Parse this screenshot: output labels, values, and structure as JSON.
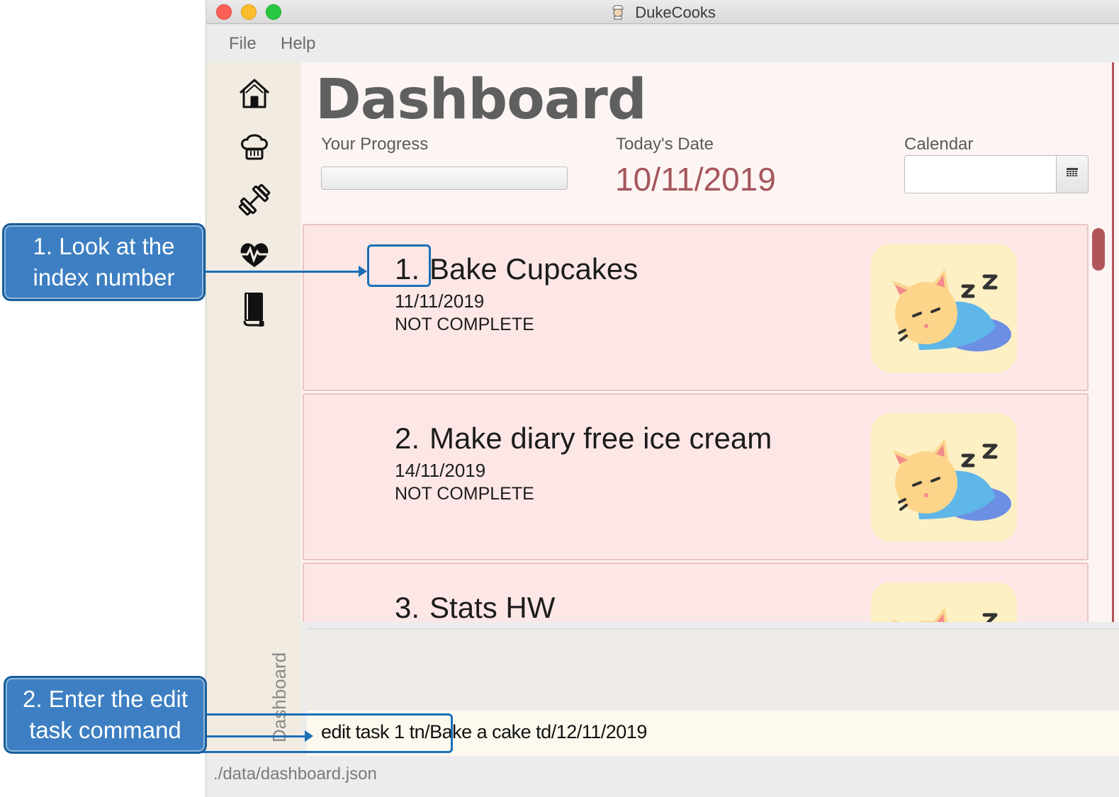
{
  "window": {
    "title": "DukeCooks"
  },
  "menu": {
    "items": [
      "File",
      "Help"
    ]
  },
  "sidebar": {
    "items": [
      {
        "icon": "home-icon"
      },
      {
        "icon": "chef-hat-icon"
      },
      {
        "icon": "dumbbell-icon"
      },
      {
        "icon": "heartbeat-icon"
      },
      {
        "icon": "diary-book-icon"
      }
    ],
    "vertical_label": "Dashboard"
  },
  "dashboard": {
    "title": "Dashboard",
    "progress_label": "Your Progress",
    "progress_value": 0,
    "today_label": "Today's Date",
    "today_date": "10/11/2019",
    "calendar_label": "Calendar",
    "calendar_value": ""
  },
  "tasks": [
    {
      "index": "1.",
      "name": "Bake Cupcakes",
      "date": "11/11/2019",
      "status": "NOT COMPLETE"
    },
    {
      "index": "2.",
      "name": "Make diary free ice cream",
      "date": "14/11/2019",
      "status": "NOT COMPLETE"
    },
    {
      "index": "3.",
      "name": "Stats HW",
      "date": "",
      "status": ""
    }
  ],
  "command": {
    "value": "edit task 1 tn/Bake a cake td/12/11/2019"
  },
  "result": {
    "text": ""
  },
  "status_bar": {
    "path": "./data/dashboard.json"
  },
  "annotations": {
    "step1": "1. Look at the index number",
    "step2": "2. Enter the edit task command"
  },
  "colors": {
    "accent": "#b2555a",
    "card_bg": "#fde7e6",
    "annotation_blue": "#3d7fc2",
    "date_color": "#a5565c"
  }
}
